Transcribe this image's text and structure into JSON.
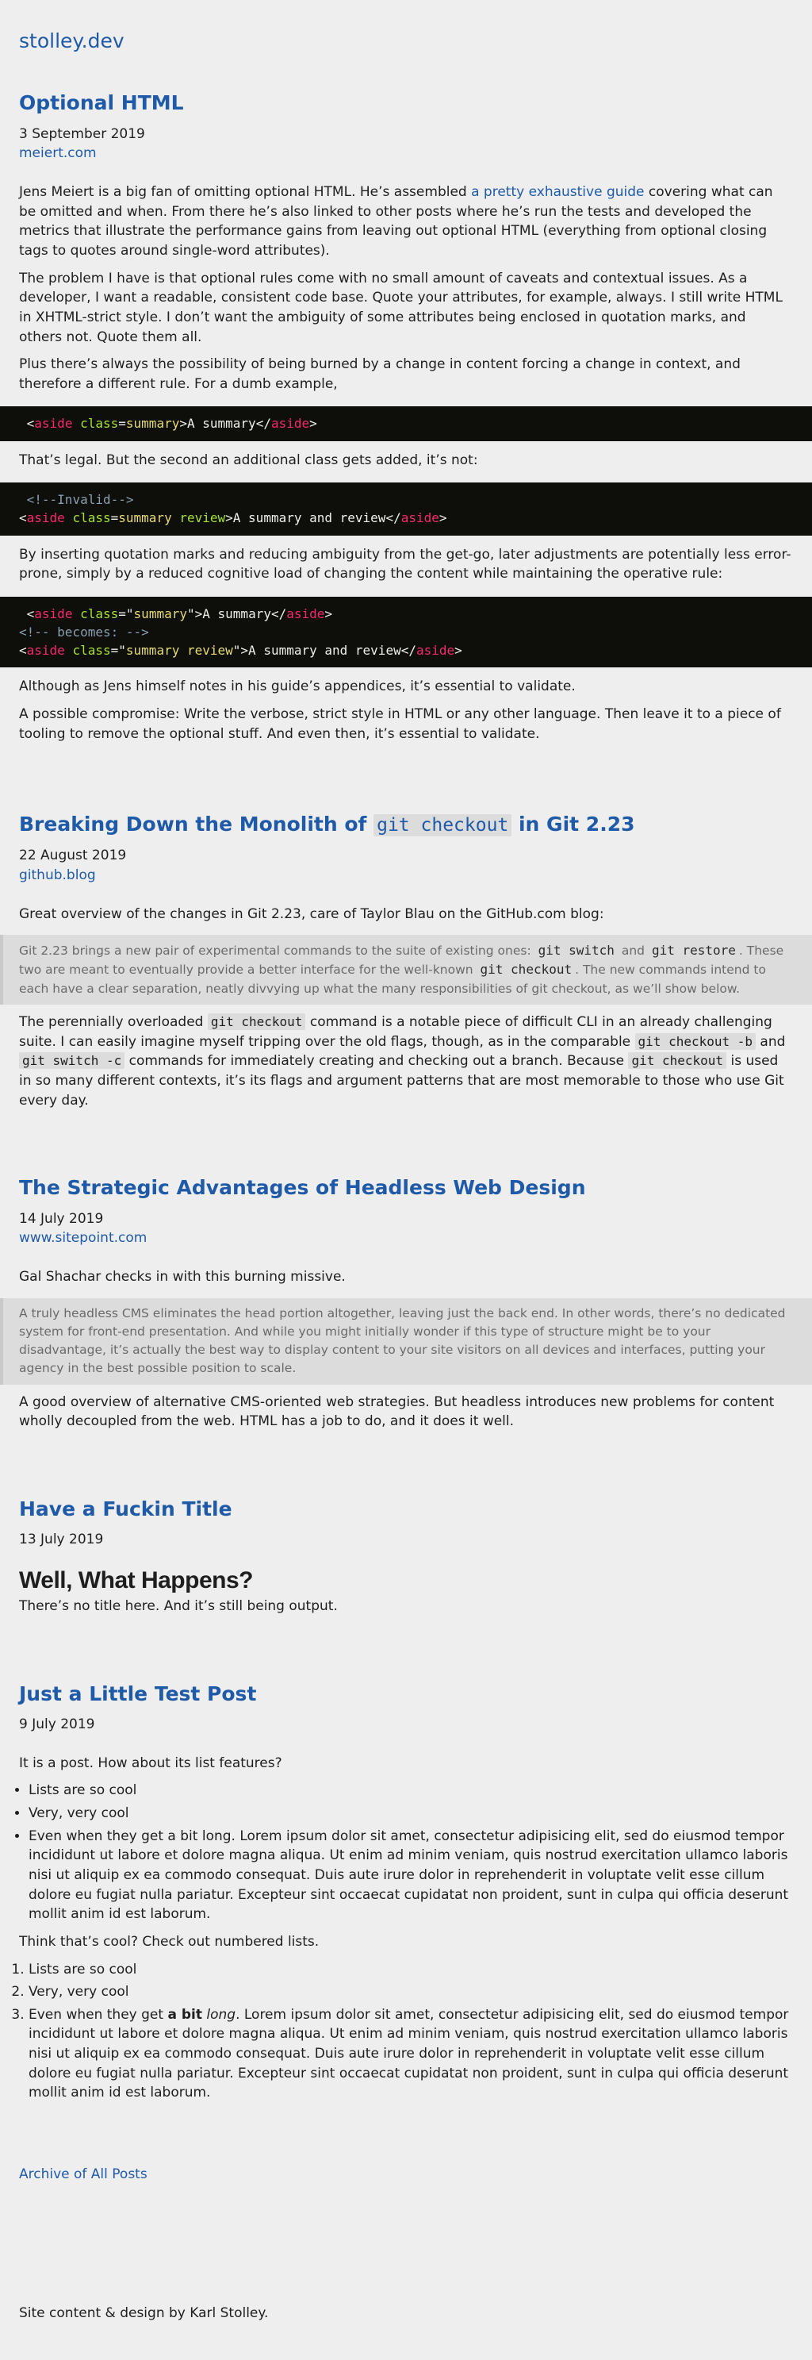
{
  "site": {
    "title": "stolley.dev"
  },
  "posts": [
    {
      "title": "Optional HTML",
      "date": "3 September 2019",
      "source": "meiert.com",
      "p1_a": "Jens Meiert is a big fan of omitting optional HTML. He’s assembled ",
      "p1_link": "a pretty exhaustive guide",
      "p1_b": " covering what can be omitted and when. From there he’s also linked to other posts where he’s run the tests and developed the metrics that illustrate the performance gains from leaving out optional HTML (everything from optional closing tags to quotes around single-word attributes).",
      "p2": "The problem I have is that optional rules come with no small amount of caveats and contextual issues. As a developer, I want a readable, consistent code base. Quote your attributes, for example, always. I still write HTML in XHTML-strict style. I don’t want the ambiguity of some attributes being enclosed in quotation marks, and others not. Quote them all.",
      "p3": "Plus there’s always the possibility of being burned by a change in content forcing a change in context, and therefore a different rule. For a dumb example,",
      "p4": "That’s legal. But the second an additional class gets added, it’s not:",
      "p5": "By inserting quotation marks and reducing ambiguity from the get-go, later adjustments are potentially less error-prone, simply by a reduced cognitive load of changing the content while maintaining the operative rule:",
      "p6": "Although as Jens himself notes in his guide’s appendices, it’s essential to validate.",
      "p7": "A possible compromise: Write the verbose, strict style in HTML or any other language. Then leave it to a piece of tooling to remove the optional stuff. And even then, it’s essential to validate.",
      "code": {
        "lt": "<",
        "gt": ">",
        "close": "</",
        "eq": "=",
        "q": "\"",
        "aside": "aside",
        "class": "class",
        "summary": "summary",
        "summary_review": "summary review",
        "review": "review",
        "text_summary": "A summary",
        "text_summary_review": "A summary and review",
        "invalid": "<!--Invalid-->",
        "becomes": "<!-- becomes: -->"
      }
    },
    {
      "title_a": "Breaking Down the Monolith of ",
      "title_code": "git checkout",
      "title_b": " in Git 2.23",
      "date": "22 August 2019",
      "source": "github.blog",
      "intro": "Great overview of the changes in Git 2.23, care of Taylor Blau on the GitHub.com blog:",
      "quote_a": "Git 2.23 brings a new pair of experimental commands to the suite of existing ones: ",
      "quote_code1": "git switch",
      "quote_b": " and ",
      "quote_code2": "git restore",
      "quote_c": ". These two are meant to eventually provide a better interface for the well-known ",
      "quote_code3": "git checkout",
      "quote_d": ". The new commands intend to each have a clear separation, neatly divvying up what the many responsibilities of git checkout, as we’ll show below.",
      "p_a": "The perennially overloaded ",
      "p_code1": "git checkout",
      "p_b": " command is a notable piece of difficult CLI in an already challenging suite. I can easily imagine myself tripping over the old flags, though, as in the comparable ",
      "p_code2": "git checkout -b",
      "p_c": " and ",
      "p_code3": "git switch -c",
      "p_d": " commands for immediately creating and checking out a branch. Because ",
      "p_code4": "git checkout",
      "p_e": " is used in so many different contexts, it’s its flags and argument patterns that are most memorable to those who use Git every day."
    },
    {
      "title": "The Strategic Advantages of Headless Web Design",
      "date": "14 July 2019",
      "source": "www.sitepoint.com",
      "intro": "Gal Shachar checks in with this burning missive.",
      "quote": "A truly headless CMS eliminates the head portion altogether, leaving just the back end. In other words, there’s no dedicated system for front-end presentation. And while you might initially wonder if this type of structure might be to your disadvantage, it’s actually the best way to display content to your site visitors on all devices and interfaces, putting your agency in the best possible position to scale.",
      "p": "A good overview of alternative CMS-oriented web strategies. But headless introduces new problems for content wholly decoupled from the web. HTML has a job to do, and it does it well."
    },
    {
      "title": "Have a Fuckin Title",
      "date": "13 July 2019",
      "heading": "Well, What Happens?",
      "p": "There’s no title here. And it’s still being output."
    },
    {
      "title": "Just a Little Test Post",
      "date": "9 July 2019",
      "intro": "It is a post. How about its list features?",
      "ul": [
        "Lists are so cool",
        "Very, very cool",
        "Even when they get a bit long. Lorem ipsum dolor sit amet, consectetur adipisicing elit, sed do eiusmod tempor incididunt ut labore et dolore magna aliqua. Ut enim ad minim veniam, quis nostrud exercitation ullamco laboris nisi ut aliquip ex ea commodo consequat. Duis aute irure dolor in reprehenderit in voluptate velit esse cillum dolore eu fugiat nulla pariatur. Excepteur sint occaecat cupidatat non proident, sunt in culpa qui officia deserunt mollit anim id est laborum."
      ],
      "mid": "Think that’s cool? Check out numbered lists.",
      "ol": [
        "Lists are so cool",
        "Very, very cool"
      ],
      "ol3_a": "Even when they get ",
      "ol3_bold": "a bit",
      "ol3_sp": " ",
      "ol3_em": "long",
      "ol3_b": ". Lorem ipsum dolor sit amet, consectetur adipisicing elit, sed do eiusmod tempor incididunt ut labore et dolore magna aliqua. Ut enim ad minim veniam, quis nostrud exercitation ullamco laboris nisi ut aliquip ex ea commodo consequat. Duis aute irure dolor in reprehenderit in voluptate velit esse cillum dolore eu fugiat nulla pariatur. Excepteur sint occaecat cupidatat non proident, sunt in culpa qui officia deserunt mollit anim id est laborum."
    }
  ],
  "archive": {
    "label": "Archive of All Posts"
  },
  "footer": {
    "text": "Site content & design by Karl Stolley."
  },
  "colors": {
    "link": "#1f5aa8",
    "background": "#eeeeee",
    "code_bg": "#0e0e0a",
    "tag": "#f52a6e",
    "attr": "#a6e22e",
    "value": "#e6db74"
  }
}
